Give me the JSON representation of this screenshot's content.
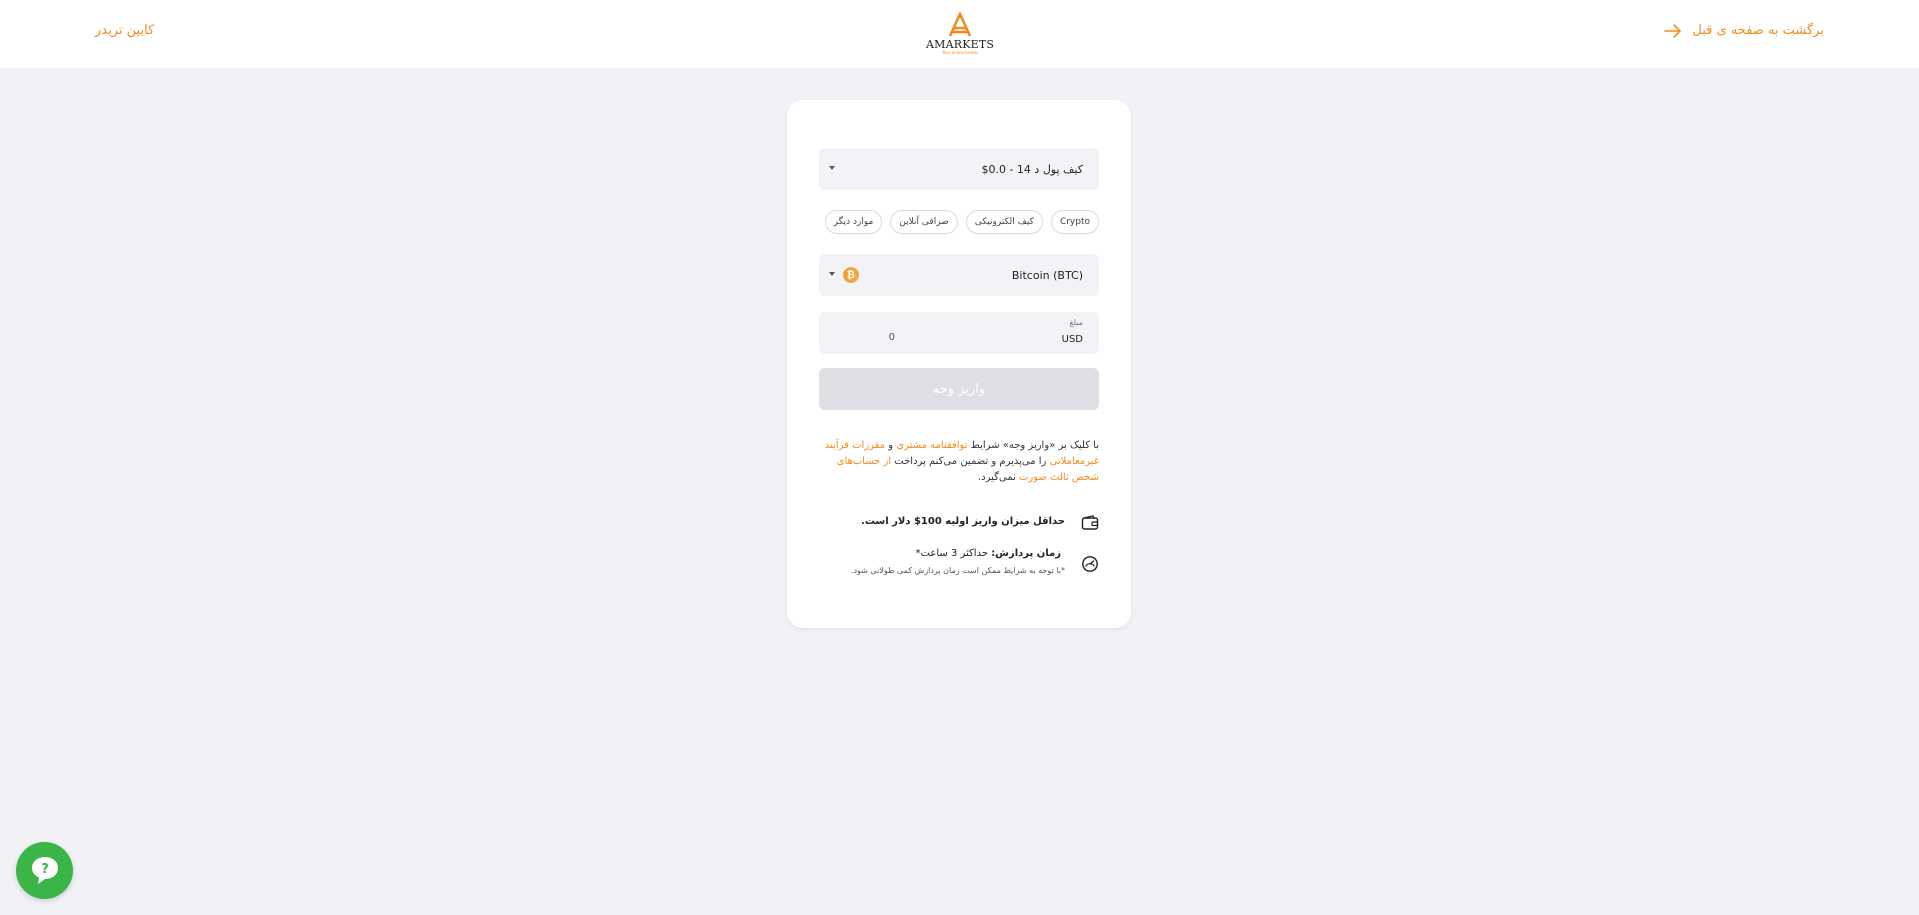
{
  "header": {
    "back_label": "برگشت به صفحه ی قبل",
    "cabinet_label": "کابین تریدر",
    "logo_text": "AMARKETS",
    "logo_tagline": "Your online broker"
  },
  "form": {
    "wallet_select_value": "کیف پول د  14 - 0.0$",
    "method_chips": [
      "Crypto",
      "کیف الکترونیکی",
      "صرافی آنلاین",
      "موارد دیگر"
    ],
    "currency_select_value": "Bitcoin (BTC)",
    "currency_icon_glyph": "₿",
    "amount_label": "مبلغ",
    "amount_currency": "USD",
    "amount_value": "0",
    "submit_label": "واریز وجه"
  },
  "terms": {
    "part1": "با کلیک بر «واریز وجه» شرایط ",
    "link1": "توافقنامه مشتری",
    "part2": " و ",
    "link2": "مقررات فرآیند غیرمعاملاتی",
    "part3": " را می‌پذیرم و تضمین می‌کنم پرداخت ",
    "link3": "از حساب‌های شخص ثالث صورت",
    "part4": " نمی‌گیرد."
  },
  "info": {
    "min_deposit": "حداقل میزان واریز اولیه 100$ دلار است.",
    "processing_label": "زمان پردازش:",
    "processing_value": " حداکثر 3 ساعت*",
    "processing_note": "*با توجه به شرایط ممکن است زمان پردازش کمی طولانی شود."
  },
  "colors": {
    "accent": "#f28a1c",
    "chat": "#3bb547",
    "background": "#f1f2f6"
  }
}
